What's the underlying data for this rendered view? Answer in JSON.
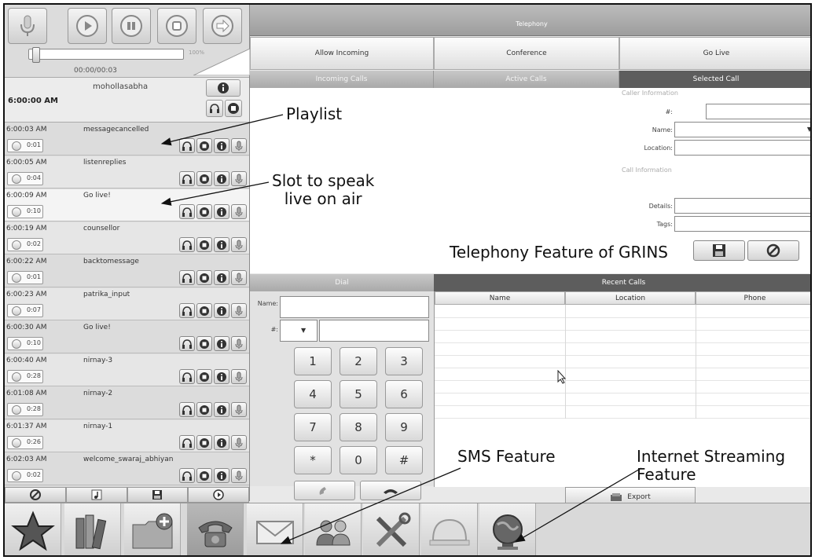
{
  "player": {
    "time_display": "00:00/00:03",
    "volume_label": "100%",
    "current_time": "6:00:00 AM",
    "current_name": "mohollasabha"
  },
  "playlist": [
    {
      "time": "6:00:03 AM",
      "name": "messagecancelled",
      "duration": "0:01"
    },
    {
      "time": "6:00:05 AM",
      "name": "listenreplies",
      "duration": "0:04"
    },
    {
      "time": "6:00:09 AM",
      "name": "Go live!",
      "duration": "0:10"
    },
    {
      "time": "6:00:19 AM",
      "name": "counsellor",
      "duration": "0:02"
    },
    {
      "time": "6:00:22 AM",
      "name": "backtomessage",
      "duration": "0:01"
    },
    {
      "time": "6:00:23 AM",
      "name": "patrika_input",
      "duration": "0:07"
    },
    {
      "time": "6:00:30 AM",
      "name": "Go live!",
      "duration": "0:10"
    },
    {
      "time": "6:00:40 AM",
      "name": "nirnay-3",
      "duration": "0:28"
    },
    {
      "time": "6:01:08 AM",
      "name": "nirnay-2",
      "duration": "0:28"
    },
    {
      "time": "6:01:37 AM",
      "name": "nirnay-1",
      "duration": "0:26"
    },
    {
      "time": "6:02:03 AM",
      "name": "welcome_swaraj_abhiyan",
      "duration": "0:02"
    }
  ],
  "telephony": {
    "title": "Telephony",
    "buttons": [
      "Allow Incoming",
      "Conference",
      "Go Live"
    ],
    "tabs": [
      "Incoming Calls",
      "Active Calls",
      "Selected Call"
    ],
    "caller_info_label": "Caller Information",
    "call_info_label": "Call Information",
    "fields": {
      "number": "#:",
      "name": "Name:",
      "location": "Location:",
      "details": "Details:",
      "tags": "Tags:"
    }
  },
  "dial": {
    "header": "Dial",
    "name_label": "Name:",
    "number_label": "#:",
    "keys": [
      "1",
      "2",
      "3",
      "4",
      "5",
      "6",
      "7",
      "8",
      "9",
      "*",
      "0",
      "#"
    ]
  },
  "recent_calls": {
    "header": "Recent Calls",
    "columns": [
      "Name",
      "Location",
      "Phone"
    ],
    "export_label": "Export"
  },
  "annotations": {
    "playlist": "Playlist",
    "slot": "Slot to speak\nlive on air",
    "telephony_feature": "Telephony Feature of GRINS",
    "sms": "SMS Feature",
    "streaming": "Internet Streaming\nFeature"
  },
  "dock": [
    "star-icon",
    "library-icon",
    "folder-add-icon",
    "telephone-icon",
    "sms-envelope-icon",
    "users-icon",
    "tools-icon",
    "helmet-icon",
    "globe-icon"
  ]
}
